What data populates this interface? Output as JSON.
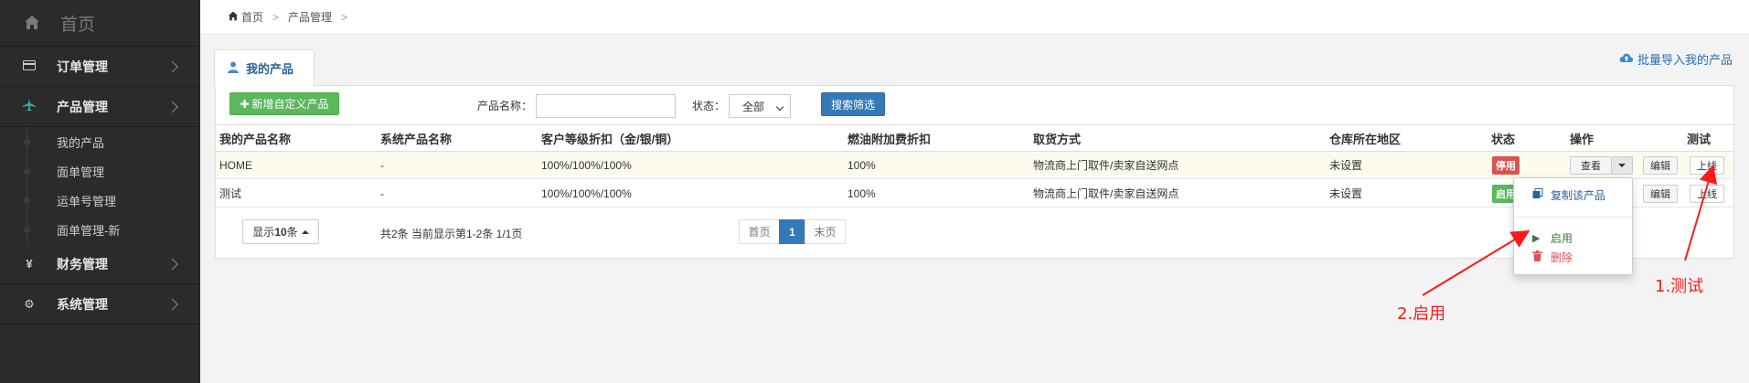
{
  "sidebar": {
    "home": {
      "label": "首页",
      "icon": "home-icon"
    },
    "items": [
      {
        "label": "订单管理",
        "icon": "card-icon"
      },
      {
        "label": "产品管理",
        "icon": "plane-icon"
      },
      {
        "label": "财务管理",
        "icon": "yen-icon"
      },
      {
        "label": "系统管理",
        "icon": "gear-icon"
      }
    ],
    "subitems": [
      "我的产品",
      "面单管理",
      "运单号管理",
      "面单管理-新"
    ]
  },
  "breadcrumb": {
    "home": "首页",
    "current": "产品管理"
  },
  "tab": {
    "label": "我的产品"
  },
  "import_link": "批量导入我的产品",
  "toolbar": {
    "add_label": "新增自定义产品",
    "name_label": "产品名称：",
    "name_value": "",
    "status_label": "状态：",
    "status_value": "全部",
    "search_label": "搜索筛选"
  },
  "table": {
    "headers": [
      "我的产品名称",
      "系统产品名称",
      "客户等级折扣（金/银/铜）",
      "燃油附加费折扣",
      "取货方式",
      "仓库所在地区",
      "状态",
      "操作",
      "测试"
    ],
    "rows": [
      {
        "name": "HOME",
        "system_name": "-",
        "discount": "100%/100%/100%",
        "fuel": "100%",
        "pickup": "物流商上门取件/卖家自送网点",
        "region": "未设置",
        "status": "停用",
        "status_color": "#d9534f",
        "view": "查看",
        "edit": "编辑",
        "test": "上线"
      },
      {
        "name": "测试",
        "system_name": "-",
        "discount": "100%/100%/100%",
        "fuel": "100%",
        "pickup": "物流商上门取件/卖家自送网点",
        "region": "未设置",
        "status": "启用",
        "status_color": "#5cb85c",
        "edit": "编辑",
        "test": "上线"
      }
    ]
  },
  "pagination": {
    "page_size_prefix": "显示",
    "page_size_value": "10",
    "page_size_suffix": "条",
    "summary": "共2条 当前显示第1-2条 1/1页",
    "first": "首页",
    "current": "1",
    "last": "末页"
  },
  "dropdown": {
    "copy": "复制该产品",
    "enable": "启用",
    "delete": "删除",
    "copy_color": "#2a6496",
    "enable_color": "#3c763d",
    "delete_color": "#d9534f"
  },
  "annotations": {
    "test": "1.测试",
    "enable": "2.启用",
    "color": "#ff1a1a"
  }
}
